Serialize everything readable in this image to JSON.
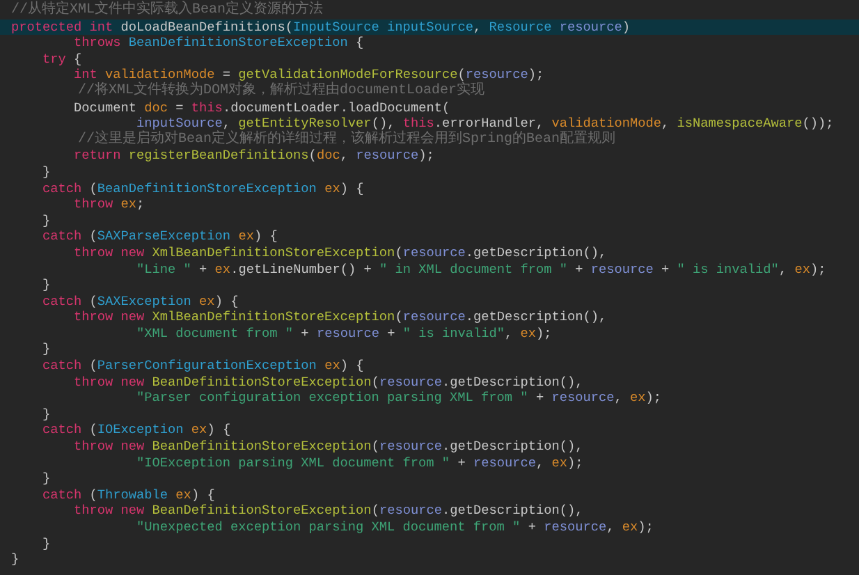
{
  "editor": {
    "lines": [
      {
        "current": false,
        "tokens": [
          {
            "kind": "comment",
            "text": "//从特定XML文件中实际载入Bean定义资源的方法"
          }
        ]
      },
      {
        "current": true,
        "tokens": [
          {
            "kind": "keyword",
            "text": "protected int "
          },
          {
            "kind": "plain",
            "text": "doLoadBeanDefinitions("
          },
          {
            "kind": "type",
            "text": "InputSource inputSource"
          },
          {
            "kind": "plain",
            "text": ", "
          },
          {
            "kind": "type",
            "text": "Resource "
          },
          {
            "kind": "field",
            "text": "resource"
          },
          {
            "kind": "plain",
            "text": ")"
          }
        ]
      },
      {
        "current": false,
        "tokens": [
          {
            "kind": "keyword",
            "text": "        throws "
          },
          {
            "kind": "type",
            "text": "BeanDefinitionStoreException "
          },
          {
            "kind": "plain",
            "text": "{"
          }
        ]
      },
      {
        "current": false,
        "tokens": [
          {
            "kind": "keyword",
            "text": "    try "
          },
          {
            "kind": "plain",
            "text": "{"
          }
        ]
      },
      {
        "current": false,
        "tokens": [
          {
            "kind": "keyword",
            "text": "        int "
          },
          {
            "kind": "variable",
            "text": "validationMode"
          },
          {
            "kind": "plain",
            "text": " = "
          },
          {
            "kind": "method",
            "text": "getValidationModeForResource"
          },
          {
            "kind": "plain",
            "text": "("
          },
          {
            "kind": "field",
            "text": "resource"
          },
          {
            "kind": "plain",
            "text": ");"
          }
        ]
      },
      {
        "current": false,
        "tokens": [
          {
            "kind": "comment",
            "text": "        //将XML文件转换为DOM对象，解析过程由documentLoader实现"
          }
        ]
      },
      {
        "current": false,
        "tokens": [
          {
            "kind": "plain",
            "text": "        Document "
          },
          {
            "kind": "variable",
            "text": "doc"
          },
          {
            "kind": "plain",
            "text": " = "
          },
          {
            "kind": "keyword",
            "text": "this"
          },
          {
            "kind": "plain",
            "text": ".documentLoader.loadDocument("
          }
        ]
      },
      {
        "current": false,
        "tokens": [
          {
            "kind": "field",
            "text": "                inputSource"
          },
          {
            "kind": "plain",
            "text": ", "
          },
          {
            "kind": "method",
            "text": "getEntityResolver"
          },
          {
            "kind": "plain",
            "text": "(), "
          },
          {
            "kind": "keyword",
            "text": "this"
          },
          {
            "kind": "plain",
            "text": ".errorHandler, "
          },
          {
            "kind": "variable",
            "text": "validationMode"
          },
          {
            "kind": "plain",
            "text": ", "
          },
          {
            "kind": "method",
            "text": "isNamespaceAware"
          },
          {
            "kind": "plain",
            "text": "());"
          }
        ]
      },
      {
        "current": false,
        "tokens": [
          {
            "kind": "comment",
            "text": "        //这里是启动对Bean定义解析的详细过程，该解析过程会用到Spring的Bean配置规则"
          }
        ]
      },
      {
        "current": false,
        "tokens": [
          {
            "kind": "keyword",
            "text": "        return "
          },
          {
            "kind": "method",
            "text": "registerBeanDefinitions"
          },
          {
            "kind": "plain",
            "text": "("
          },
          {
            "kind": "variable",
            "text": "doc"
          },
          {
            "kind": "plain",
            "text": ", "
          },
          {
            "kind": "field",
            "text": "resource"
          },
          {
            "kind": "plain",
            "text": ");"
          }
        ]
      },
      {
        "current": false,
        "tokens": [
          {
            "kind": "plain",
            "text": "    }"
          }
        ]
      },
      {
        "current": false,
        "tokens": [
          {
            "kind": "keyword",
            "text": "    catch "
          },
          {
            "kind": "plain",
            "text": "("
          },
          {
            "kind": "type",
            "text": "BeanDefinitionStoreException "
          },
          {
            "kind": "variable",
            "text": "ex"
          },
          {
            "kind": "plain",
            "text": ") {"
          }
        ]
      },
      {
        "current": false,
        "tokens": [
          {
            "kind": "keyword",
            "text": "        throw "
          },
          {
            "kind": "variable",
            "text": "ex"
          },
          {
            "kind": "plain",
            "text": ";"
          }
        ]
      },
      {
        "current": false,
        "tokens": [
          {
            "kind": "plain",
            "text": "    }"
          }
        ]
      },
      {
        "current": false,
        "tokens": [
          {
            "kind": "keyword",
            "text": "    catch "
          },
          {
            "kind": "plain",
            "text": "("
          },
          {
            "kind": "type",
            "text": "SAXParseException "
          },
          {
            "kind": "variable",
            "text": "ex"
          },
          {
            "kind": "plain",
            "text": ") {"
          }
        ]
      },
      {
        "current": false,
        "tokens": [
          {
            "kind": "keyword",
            "text": "        throw new "
          },
          {
            "kind": "method",
            "text": "XmlBeanDefinitionStoreException"
          },
          {
            "kind": "plain",
            "text": "("
          },
          {
            "kind": "field",
            "text": "resource"
          },
          {
            "kind": "plain",
            "text": ".getDescription(),"
          }
        ]
      },
      {
        "current": false,
        "tokens": [
          {
            "kind": "string",
            "text": "                \"Line \""
          },
          {
            "kind": "plain",
            "text": " + "
          },
          {
            "kind": "variable",
            "text": "ex"
          },
          {
            "kind": "plain",
            "text": ".getLineNumber() + "
          },
          {
            "kind": "string",
            "text": "\" in XML document from \""
          },
          {
            "kind": "plain",
            "text": " + "
          },
          {
            "kind": "field",
            "text": "resource"
          },
          {
            "kind": "plain",
            "text": " + "
          },
          {
            "kind": "string",
            "text": "\" is invalid\""
          },
          {
            "kind": "plain",
            "text": ", "
          },
          {
            "kind": "variable",
            "text": "ex"
          },
          {
            "kind": "plain",
            "text": ");"
          }
        ]
      },
      {
        "current": false,
        "tokens": [
          {
            "kind": "plain",
            "text": "    }"
          }
        ]
      },
      {
        "current": false,
        "tokens": [
          {
            "kind": "keyword",
            "text": "    catch "
          },
          {
            "kind": "plain",
            "text": "("
          },
          {
            "kind": "type",
            "text": "SAXException "
          },
          {
            "kind": "variable",
            "text": "ex"
          },
          {
            "kind": "plain",
            "text": ") {"
          }
        ]
      },
      {
        "current": false,
        "tokens": [
          {
            "kind": "keyword",
            "text": "        throw new "
          },
          {
            "kind": "method",
            "text": "XmlBeanDefinitionStoreException"
          },
          {
            "kind": "plain",
            "text": "("
          },
          {
            "kind": "field",
            "text": "resource"
          },
          {
            "kind": "plain",
            "text": ".getDescription(),"
          }
        ]
      },
      {
        "current": false,
        "tokens": [
          {
            "kind": "string",
            "text": "                \"XML document from \""
          },
          {
            "kind": "plain",
            "text": " + "
          },
          {
            "kind": "field",
            "text": "resource"
          },
          {
            "kind": "plain",
            "text": " + "
          },
          {
            "kind": "string",
            "text": "\" is invalid\""
          },
          {
            "kind": "plain",
            "text": ", "
          },
          {
            "kind": "variable",
            "text": "ex"
          },
          {
            "kind": "plain",
            "text": ");"
          }
        ]
      },
      {
        "current": false,
        "tokens": [
          {
            "kind": "plain",
            "text": "    }"
          }
        ]
      },
      {
        "current": false,
        "tokens": [
          {
            "kind": "keyword",
            "text": "    catch "
          },
          {
            "kind": "plain",
            "text": "("
          },
          {
            "kind": "type",
            "text": "ParserConfigurationException "
          },
          {
            "kind": "variable",
            "text": "ex"
          },
          {
            "kind": "plain",
            "text": ") {"
          }
        ]
      },
      {
        "current": false,
        "tokens": [
          {
            "kind": "keyword",
            "text": "        throw new "
          },
          {
            "kind": "method",
            "text": "BeanDefinitionStoreException"
          },
          {
            "kind": "plain",
            "text": "("
          },
          {
            "kind": "field",
            "text": "resource"
          },
          {
            "kind": "plain",
            "text": ".getDescription(),"
          }
        ]
      },
      {
        "current": false,
        "tokens": [
          {
            "kind": "string",
            "text": "                \"Parser configuration exception parsing XML from \""
          },
          {
            "kind": "plain",
            "text": " + "
          },
          {
            "kind": "field",
            "text": "resource"
          },
          {
            "kind": "plain",
            "text": ", "
          },
          {
            "kind": "variable",
            "text": "ex"
          },
          {
            "kind": "plain",
            "text": ");"
          }
        ]
      },
      {
        "current": false,
        "tokens": [
          {
            "kind": "plain",
            "text": "    }"
          }
        ]
      },
      {
        "current": false,
        "tokens": [
          {
            "kind": "keyword",
            "text": "    catch "
          },
          {
            "kind": "plain",
            "text": "("
          },
          {
            "kind": "type",
            "text": "IOException "
          },
          {
            "kind": "variable",
            "text": "ex"
          },
          {
            "kind": "plain",
            "text": ") {"
          }
        ]
      },
      {
        "current": false,
        "tokens": [
          {
            "kind": "keyword",
            "text": "        throw new "
          },
          {
            "kind": "method",
            "text": "BeanDefinitionStoreException"
          },
          {
            "kind": "plain",
            "text": "("
          },
          {
            "kind": "field",
            "text": "resource"
          },
          {
            "kind": "plain",
            "text": ".getDescription(),"
          }
        ]
      },
      {
        "current": false,
        "tokens": [
          {
            "kind": "string",
            "text": "                \"IOException parsing XML document from \""
          },
          {
            "kind": "plain",
            "text": " + "
          },
          {
            "kind": "field",
            "text": "resource"
          },
          {
            "kind": "plain",
            "text": ", "
          },
          {
            "kind": "variable",
            "text": "ex"
          },
          {
            "kind": "plain",
            "text": ");"
          }
        ]
      },
      {
        "current": false,
        "tokens": [
          {
            "kind": "plain",
            "text": "    }"
          }
        ]
      },
      {
        "current": false,
        "tokens": [
          {
            "kind": "keyword",
            "text": "    catch "
          },
          {
            "kind": "plain",
            "text": "("
          },
          {
            "kind": "type",
            "text": "Throwable "
          },
          {
            "kind": "variable",
            "text": "ex"
          },
          {
            "kind": "plain",
            "text": ") {"
          }
        ]
      },
      {
        "current": false,
        "tokens": [
          {
            "kind": "keyword",
            "text": "        throw new "
          },
          {
            "kind": "method",
            "text": "BeanDefinitionStoreException"
          },
          {
            "kind": "plain",
            "text": "("
          },
          {
            "kind": "field",
            "text": "resource"
          },
          {
            "kind": "plain",
            "text": ".getDescription(),"
          }
        ]
      },
      {
        "current": false,
        "tokens": [
          {
            "kind": "string",
            "text": "                \"Unexpected exception parsing XML document from \""
          },
          {
            "kind": "plain",
            "text": " + "
          },
          {
            "kind": "field",
            "text": "resource"
          },
          {
            "kind": "plain",
            "text": ", "
          },
          {
            "kind": "variable",
            "text": "ex"
          },
          {
            "kind": "plain",
            "text": ");"
          }
        ]
      },
      {
        "current": false,
        "tokens": [
          {
            "kind": "plain",
            "text": "    }"
          }
        ]
      },
      {
        "current": false,
        "tokens": [
          {
            "kind": "plain",
            "text": "}"
          }
        ]
      }
    ]
  }
}
